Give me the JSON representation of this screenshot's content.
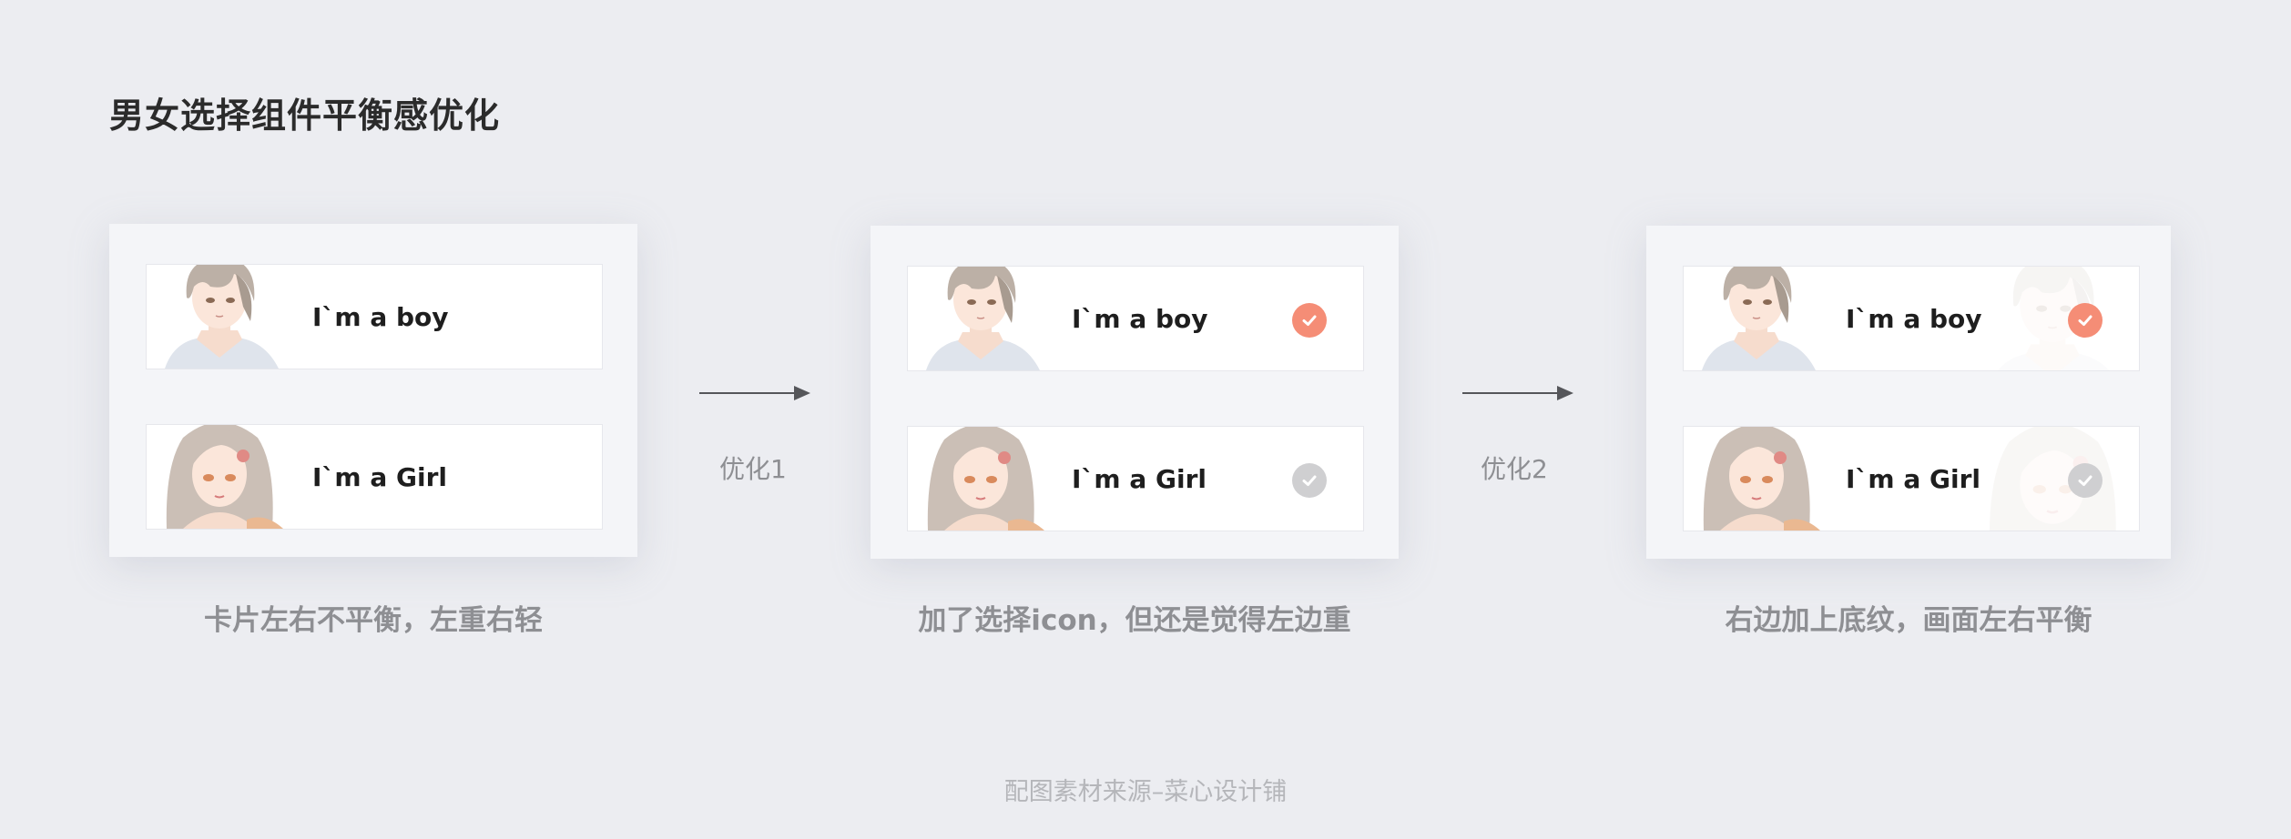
{
  "title": "男女选择组件平衡感优化",
  "cards": {
    "boy_label": "I`m a boy",
    "girl_label": "I`m a Girl"
  },
  "steps": [
    {
      "caption": "卡片左右不平衡，左重右轻"
    },
    {
      "caption": "加了选择icon，但还是觉得左边重"
    },
    {
      "caption": "右边加上底纹，画面左右平衡"
    }
  ],
  "arrows": [
    {
      "label": "优化1"
    },
    {
      "label": "优化2"
    }
  ],
  "footer": "配图素材来源–菜心设计铺",
  "colors": {
    "background": "#ecedf1",
    "panel": "#f4f5f8",
    "check_selected": "#f58d76",
    "check_unselected": "#cfcfd1"
  },
  "icons": [
    "boy-avatar-icon",
    "girl-avatar-icon",
    "check-selected-icon",
    "check-unselected-icon",
    "arrow-right-icon"
  ]
}
